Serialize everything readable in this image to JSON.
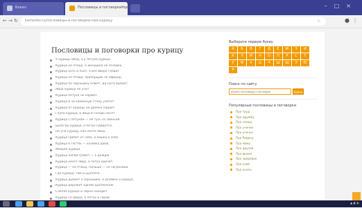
{
  "browser": {
    "tabs": [
      {
        "title": "Бокал"
      },
      {
        "title": "Пословицы и поговорки про курицу"
      }
    ],
    "url": "kartaslov.ru/пословицы-и-поговорки-про-курицу"
  },
  "page": {
    "title": "Пословицы и поговорки про курицу",
    "proverbs": [
      "У курицы обед, а у петуха курица.",
      "Курица не птица, а женщина не человек.",
      "Курица хоть и пьёт, а всё вверх глядит.",
      "Курица не птица, прапорщик не офицер.",
      "Курица по зёрнышку клюёт, да сыта бывает.",
      "Яйца курицу не учат.",
      "Курица петуха не кормит.",
      "Курица и за каменную стену улетит.",
      "Курица от курицы не далеко падает.",
      "Глупа курица, а яйца в гнездо несёт.",
      "Курица с петухом — не гусь со свиньёй.",
      "Была бы курица, а петух найдётся.",
      "Не учи курицу, как нести яйца.",
      "Курица гребёт от себя, а кошка к себе.",
      "Курица в гостях — хозяйка дома.",
      "Мокрая курица.",
      "Курица лапой гребёт — к дождю.",
      "Курица несёт яйцо, а петух кричит.",
      "Курица — не птица, Польша — не заграница.",
      "Где курица, там и цыплята.",
      "Курица думает о зёрнышке, а хозяйка о курице.",
      "Курица дорожит одним цыплёнком.",
      "Слепая курица и зерно находит.",
      "Курица со двора, а петух в сарай.",
      "Курица — не птица, баба — не человек."
    ]
  },
  "sidebar": {
    "letters_heading": "Выберите первую букву",
    "letters": [
      "А",
      "Б",
      "В",
      "Г",
      "Д",
      "Е",
      "Ж",
      "З",
      "И",
      "К",
      "Л",
      "М",
      "Н",
      "О",
      "П",
      "Р",
      "С",
      "Т",
      "У",
      "Ф",
      "Х",
      "Ц",
      "Ч",
      "Ш",
      "Щ",
      "Э",
      "Ю",
      "Я"
    ],
    "search_heading": "Поиск по сайту",
    "search_placeholder": "Искать пословицы и поговорки",
    "search_button": "Найти",
    "popular_heading": "Популярные пословицы и поговорки",
    "popular": [
      "Про труд",
      "Про дружбу",
      "Про семью",
      "Про учение",
      "Про ученье",
      "Про Родину",
      "Про маму",
      "Про друзей",
      "Про время",
      "Про здоровье",
      "Про хлеб",
      "Про книги"
    ]
  },
  "colors": {
    "accent": "#f29b00",
    "tabbar": "#3a3f91",
    "taskbar": "#1b1f3f"
  },
  "icons": {
    "up": "arrow-up-icon"
  }
}
